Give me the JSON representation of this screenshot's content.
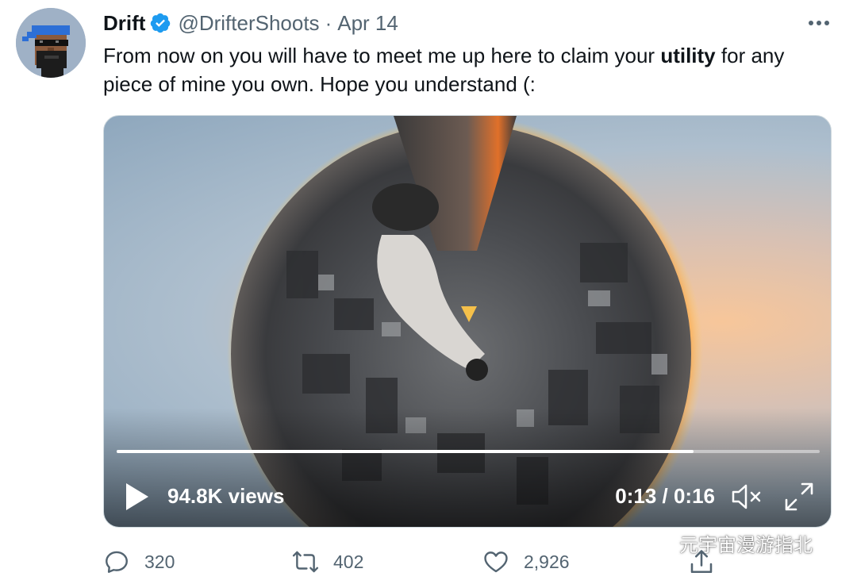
{
  "author": {
    "name": "Drift",
    "handle": "@DrifterShoots",
    "separator": "·",
    "date": "Apr 14",
    "verified": true
  },
  "tweet": {
    "text_part1": "From now on you will have to meet me up here to claim your ",
    "text_bold": "utility",
    "text_part2": " for any piece of mine you own. Hope you understand (:"
  },
  "video": {
    "views": "94.8K views",
    "time": "0:13 / 0:16",
    "progress": 0.82,
    "icons": {
      "play": "play-icon",
      "mute": "volume-muted-icon",
      "fullscreen": "fullscreen-icon"
    }
  },
  "actions": {
    "replies": "320",
    "retweets": "402",
    "likes": "2,926",
    "icons": [
      "reply-icon",
      "retweet-icon",
      "like-icon",
      "share-icon"
    ]
  },
  "watermark": {
    "text": "元宇宙漫游指北"
  },
  "colors": {
    "verified": "#1d9bf0",
    "secondary_text": "#536471",
    "primary_text": "#0f1419"
  }
}
